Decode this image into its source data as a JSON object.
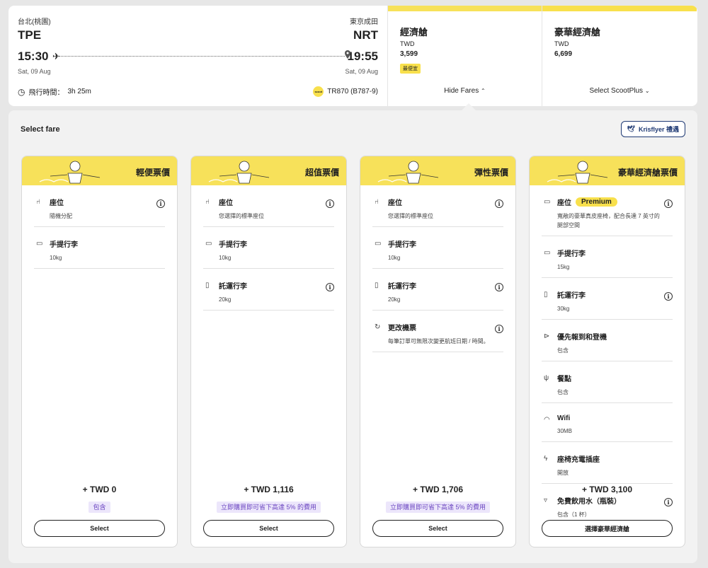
{
  "flight": {
    "origin_city": "台北(桃園)",
    "dest_city": "東京成田",
    "origin_code": "TPE",
    "dest_code": "NRT",
    "depart_time": "15:30",
    "arrive_time": "19:55",
    "depart_date": "Sat, 09 Aug",
    "arrive_date": "Sat, 09 Aug",
    "duration_label": "飛行時間：",
    "duration": "3h 25m",
    "airline_logo_text": "scoot",
    "flight_number": "TR870 (B787-9)"
  },
  "cabins": [
    {
      "name": "經濟艙",
      "currency": "TWD",
      "price": "3,599",
      "tag": "最便宜",
      "toggle": "Hide Fares",
      "toggle_icon": "chevron-up-icon",
      "stripe_color": "#f7e15a"
    },
    {
      "name": "豪華經濟艙",
      "currency": "TWD",
      "price": "6,699",
      "tag": "",
      "toggle": "Select ScootPlus",
      "toggle_icon": "chevron-down-icon",
      "stripe_color": "#f8e04c"
    }
  ],
  "panel": {
    "title": "Select fare",
    "krisflyer": "Krisflyer 禮遇"
  },
  "fares": [
    {
      "title": "輕便票價",
      "items": [
        {
          "icon": "seat-icon",
          "name": "座位",
          "desc": "隨機分配",
          "info": true
        },
        {
          "icon": "cabin-bag-icon",
          "name": "手提行李",
          "desc": "10kg",
          "info": false
        }
      ],
      "total": "+ TWD 0",
      "promo": "包含",
      "button": "Select"
    },
    {
      "title": "超值票價",
      "items": [
        {
          "icon": "seat-icon",
          "name": "座位",
          "desc": "您選擇的標準座位",
          "info": true
        },
        {
          "icon": "cabin-bag-icon",
          "name": "手提行李",
          "desc": "10kg",
          "info": false
        },
        {
          "icon": "checked-bag-icon",
          "name": "託運行李",
          "desc": "20kg",
          "info": true
        }
      ],
      "total": "+ TWD 1,116",
      "promo": "立即購買即可省下高達 5% 的費用",
      "button": "Select"
    },
    {
      "title": "彈性票價",
      "items": [
        {
          "icon": "seat-icon",
          "name": "座位",
          "desc": "您選擇的標準座位",
          "info": true
        },
        {
          "icon": "cabin-bag-icon",
          "name": "手提行李",
          "desc": "10kg",
          "info": false
        },
        {
          "icon": "checked-bag-icon",
          "name": "託運行李",
          "desc": "20kg",
          "info": true
        },
        {
          "icon": "change-flight-icon",
          "name": "更改機票",
          "desc": "每筆訂單可無限次變更航班日期 / 時間。",
          "info": true
        }
      ],
      "total": "+ TWD 1,706",
      "promo": "立即購買即可省下高達 5% 的費用",
      "button": "Select"
    },
    {
      "title": "豪華經濟艙票價",
      "items": [
        {
          "icon": "premium-seat-icon",
          "name": "座位",
          "badge": "Premium",
          "desc": "寬敞的豪華真皮座椅，配合長達 7 英寸的腿部空間",
          "info": true
        },
        {
          "icon": "cabin-bag-icon",
          "name": "手提行李",
          "desc": "15kg",
          "info": false
        },
        {
          "icon": "checked-bag-icon",
          "name": "託運行李",
          "desc": "30kg",
          "info": true
        },
        {
          "icon": "priority-icon",
          "name": "優先報到和登機",
          "desc": "包含",
          "info": false
        },
        {
          "icon": "meal-icon",
          "name": "餐點",
          "desc": "包含",
          "info": false
        },
        {
          "icon": "wifi-icon",
          "name": "Wifi",
          "desc": "30MB",
          "info": false
        },
        {
          "icon": "power-icon",
          "name": "座椅充電插座",
          "desc": "開放",
          "info": false
        },
        {
          "icon": "water-icon",
          "name": "免費飲用水（瓶裝）",
          "desc": "包含（1 杯）",
          "info": true
        }
      ],
      "total": "+ TWD 3,100",
      "promo": "",
      "button": "選擇豪華經濟艙"
    }
  ]
}
